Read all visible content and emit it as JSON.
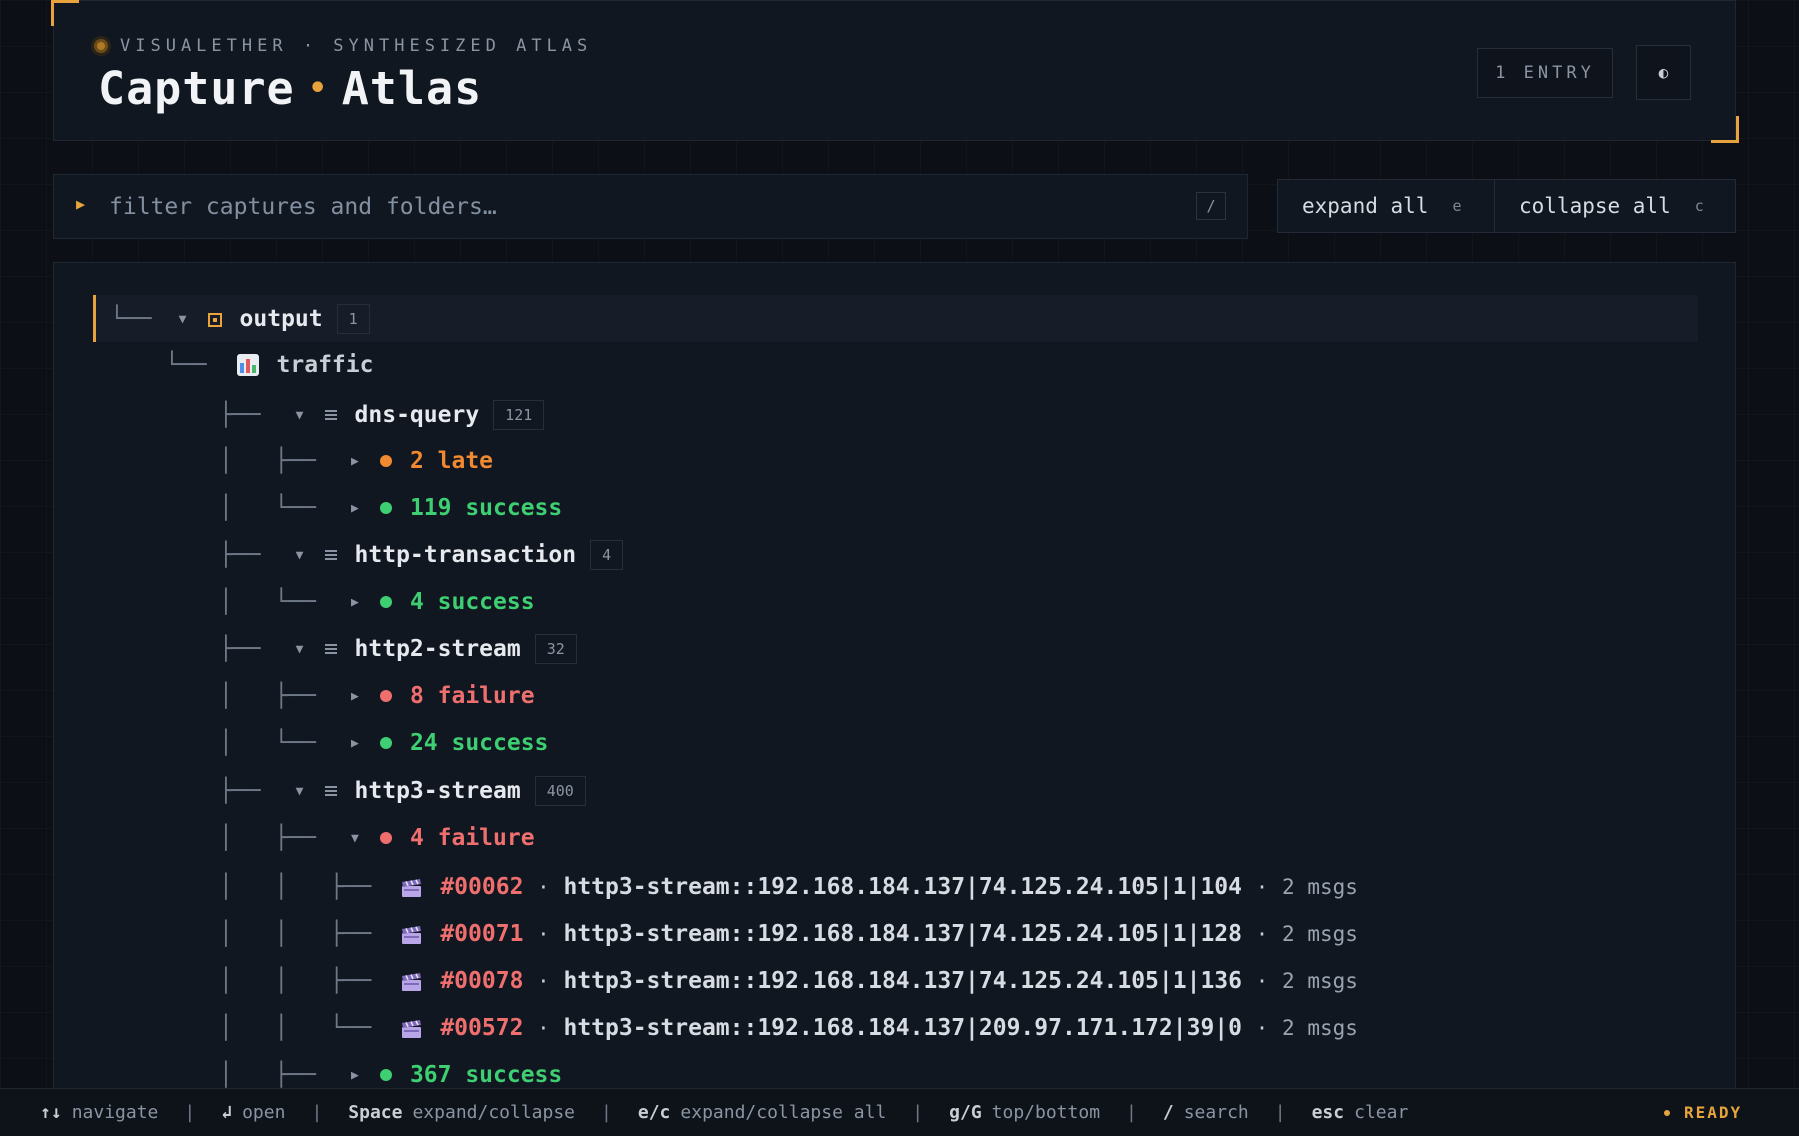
{
  "header": {
    "brand": "VISUALETHER · SYNTHESIZED ATLAS",
    "title_left": "Capture",
    "title_sep": "•",
    "title_right": "Atlas",
    "entry_badge": "1 ENTRY",
    "theme_icon": "◐"
  },
  "search": {
    "prompt_icon": "▶",
    "placeholder": "filter captures and folders…",
    "value": "",
    "shortcut": "/"
  },
  "actions": {
    "expand_label": "expand all",
    "expand_key": "e",
    "collapse_label": "collapse all",
    "collapse_key": "c"
  },
  "colors": {
    "accent": "#e8a33d",
    "late": "#f0892f",
    "success": "#3ecf72",
    "failure": "#ef6f6f"
  },
  "tree": {
    "root": {
      "guide": "└──",
      "toggle": "▼",
      "name": "output",
      "count": "1"
    },
    "traffic": {
      "guide": "└──",
      "name": "traffic",
      "icon": "chart-icon"
    },
    "groups": [
      {
        "guide": "├──",
        "toggle": "▼",
        "name": "dns-query",
        "count": "121"
      },
      {
        "guide": "├──",
        "toggle": "▼",
        "name": "http-transaction",
        "count": "4"
      },
      {
        "guide": "├──",
        "toggle": "▼",
        "name": "http2-stream",
        "count": "32"
      },
      {
        "guide": "├──",
        "toggle": "▼",
        "name": "http3-stream",
        "count": "400"
      }
    ],
    "status": [
      {
        "prefix": "│   ├──",
        "toggle": "▶",
        "label": "2 late",
        "kind": "late"
      },
      {
        "prefix": "│   └──",
        "toggle": "▶",
        "label": "119 success",
        "kind": "success"
      },
      {
        "prefix": "│   └──",
        "toggle": "▶",
        "label": "4 success",
        "kind": "success"
      },
      {
        "prefix": "│   ├──",
        "toggle": "▶",
        "label": "8 failure",
        "kind": "failure"
      },
      {
        "prefix": "│   └──",
        "toggle": "▶",
        "label": "24 success",
        "kind": "success"
      },
      {
        "prefix": "│   ├──",
        "toggle": "▼",
        "label": "4 failure",
        "kind": "failure"
      },
      {
        "prefix": "│   ├──",
        "toggle": "▶",
        "label": "367 success",
        "kind": "success"
      }
    ],
    "captures": [
      {
        "prefix": "│   │   ├──",
        "id": "#00062",
        "sep": "·",
        "name": "http3-stream::192.168.184.137|74.125.24.105|1|104",
        "sep2": "·",
        "msgs": "2 msgs"
      },
      {
        "prefix": "│   │   ├──",
        "id": "#00071",
        "sep": "·",
        "name": "http3-stream::192.168.184.137|74.125.24.105|1|128",
        "sep2": "·",
        "msgs": "2 msgs"
      },
      {
        "prefix": "│   │   ├──",
        "id": "#00078",
        "sep": "·",
        "name": "http3-stream::192.168.184.137|74.125.24.105|1|136",
        "sep2": "·",
        "msgs": "2 msgs"
      },
      {
        "prefix": "│   │   └──",
        "id": "#00572",
        "sep": "·",
        "name": "http3-stream::192.168.184.137|209.97.171.172|39|0",
        "sep2": "·",
        "msgs": "2 msgs"
      }
    ]
  },
  "footer": {
    "navigate_key": "↑↓",
    "navigate": "navigate",
    "open_key": "↲",
    "open": "open",
    "space_key": "Space",
    "space": "expand/collapse",
    "ec_key": "e/c",
    "ec": "expand/collapse all",
    "g_key": "g/G",
    "g": "top/bottom",
    "search_key": "/",
    "search": "search",
    "esc_key": "esc",
    "esc": "clear",
    "status": "READY",
    "divider": "|"
  }
}
